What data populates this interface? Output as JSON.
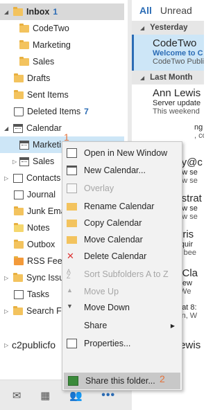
{
  "folders": {
    "inbox": {
      "label": "Inbox",
      "count": "1"
    },
    "inbox_children": [
      "CodeTwo",
      "Marketing",
      "Sales"
    ],
    "drafts": "Drafts",
    "sent": "Sent Items",
    "deleted": {
      "label": "Deleted Items",
      "count": "7"
    },
    "calendar": "Calendar",
    "calendar_children": [
      "Marketi",
      "Sales"
    ],
    "contacts": "Contacts",
    "journal": "Journal",
    "junk": "Junk Ema",
    "notes": "Notes",
    "outbox": "Outbox",
    "rss": "RSS Feeds",
    "sync": "Sync Issu",
    "tasks": "Tasks",
    "search": "Search Fo",
    "account": "c2publicfo"
  },
  "bottom_nav": [
    "mail-icon",
    "calendar-icon",
    "people-icon",
    "more-icon"
  ],
  "bottom_nav_more": "•••",
  "message_list": {
    "tab_all": "All",
    "tab_unread": "Unread",
    "groups": [
      {
        "header": "Yesterday",
        "messages": [
          {
            "from": "CodeTwo",
            "subject": "Welcome to C",
            "preview": "CodeTwo Publi"
          }
        ]
      },
      {
        "header": "Last Month",
        "messages": [
          {
            "from": "Ann Lewis",
            "subject": "Server update",
            "preview": "This weekend"
          },
          {
            "from": "",
            "subject": "ng LAB",
            "preview": ", coul"
          },
          {
            "from": "ply@c",
            "subject": "new se",
            "preview": "new se"
          },
          {
            "from": "nistrat",
            "subject": "new se",
            "preview": "new se"
          },
          {
            "from": "arris",
            "subject": "requir",
            "preview": "ve bee"
          },
          {
            "from": "a Cla",
            "subject": "r new",
            "preview": "r, We"
          },
          {
            "from": "",
            "subject": "Meeting at 8:",
            "preview": "Hello Ben, W"
          },
          {
            "from": "Ann Lewis",
            "subject": "",
            "preview": ""
          }
        ]
      }
    ]
  },
  "context_menu": {
    "items": [
      {
        "label": "Open in New Window",
        "accel": "W"
      },
      {
        "label": "New Calendar...",
        "accel": "N"
      },
      {
        "label": "Overlay",
        "accel": "O"
      },
      {
        "label": "Rename Calendar",
        "accel": "R"
      },
      {
        "label": "Copy Calendar",
        "accel": "C"
      },
      {
        "label": "Move Calendar",
        "accel": "M"
      },
      {
        "label": "Delete Calendar",
        "accel": "D"
      },
      {
        "label": "Sort Subfolders A to Z",
        "accel": "Z"
      },
      {
        "label": "Move Up",
        "accel": "U"
      },
      {
        "label": "Move Down",
        "accel": "o"
      },
      {
        "label": "Share",
        "accel": "S"
      },
      {
        "label": "Properties...",
        "accel": "P"
      },
      {
        "label": "Share this folder...",
        "accel": ""
      }
    ]
  },
  "step_badges": [
    "1",
    "2"
  ],
  "colors": {
    "accent": "#2b6cb5",
    "badge": "#e4713a",
    "selection": "#cde6f7"
  }
}
